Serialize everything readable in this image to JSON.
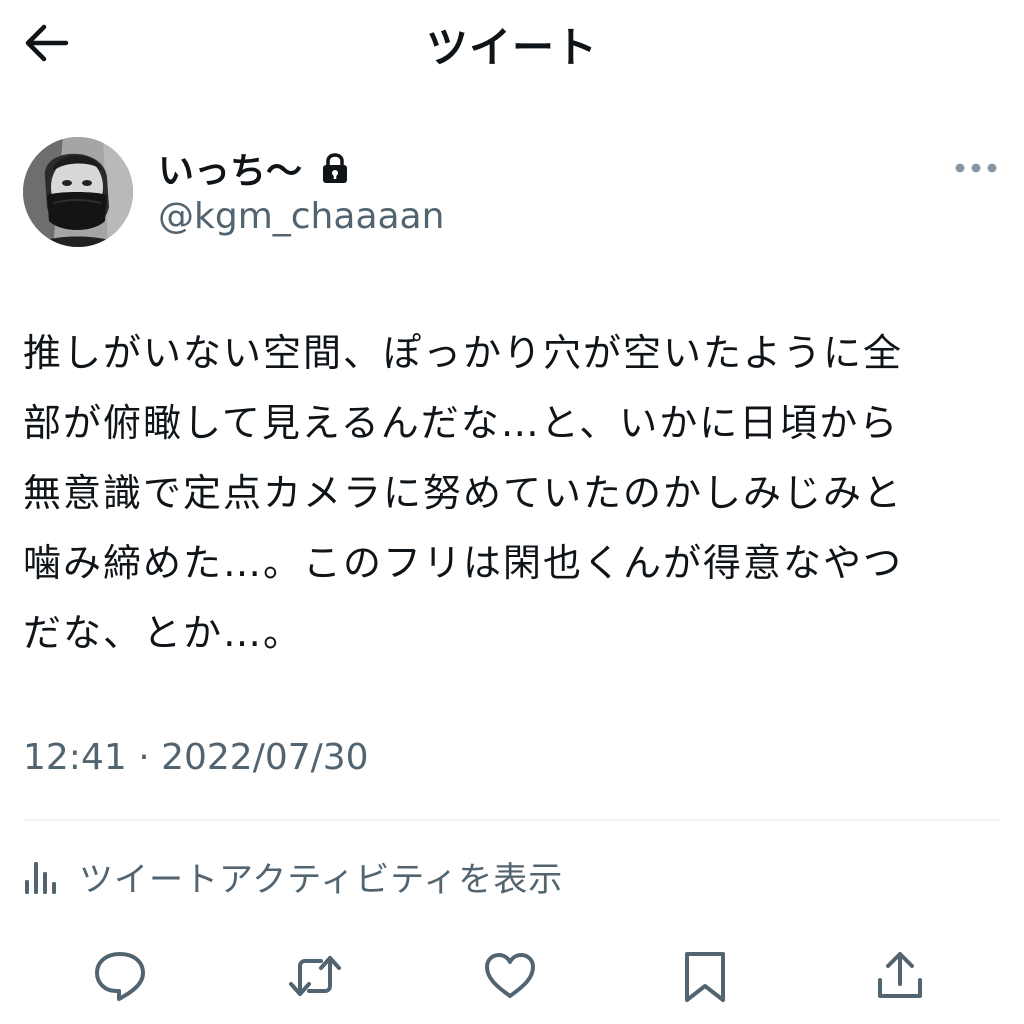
{
  "header": {
    "title": "ツイート",
    "back_icon": "arrow-left-icon"
  },
  "tweet": {
    "author": {
      "display_name": "いっち〜",
      "handle": "@kgm_chaaaan",
      "protected_icon": "lock-icon"
    },
    "more_icon": "ellipsis-icon",
    "text_lines": [
      "推しがいない空間、ぽっかり穴が空いたように全",
      "部が俯瞰して見えるんだな…と、いかに日頃から",
      "無意識で定点カメラに努めていたのかしみじみと",
      "噛み締めた…。このフリは閑也くんが得意なやつ",
      "だな、とか…。"
    ],
    "timestamp": "12:41 · 2022/07/30",
    "activity_label": "ツイートアクティビティを表示"
  },
  "actions": [
    {
      "name": "reply",
      "icon": "reply-icon"
    },
    {
      "name": "retweet",
      "icon": "retweet-icon"
    },
    {
      "name": "like",
      "icon": "heart-icon"
    },
    {
      "name": "bookmark",
      "icon": "bookmark-icon"
    },
    {
      "name": "share",
      "icon": "share-icon"
    }
  ],
  "colors": {
    "text_primary": "#0f1419",
    "text_secondary": "#536471",
    "divider": "#eff3f4",
    "background": "#ffffff"
  }
}
